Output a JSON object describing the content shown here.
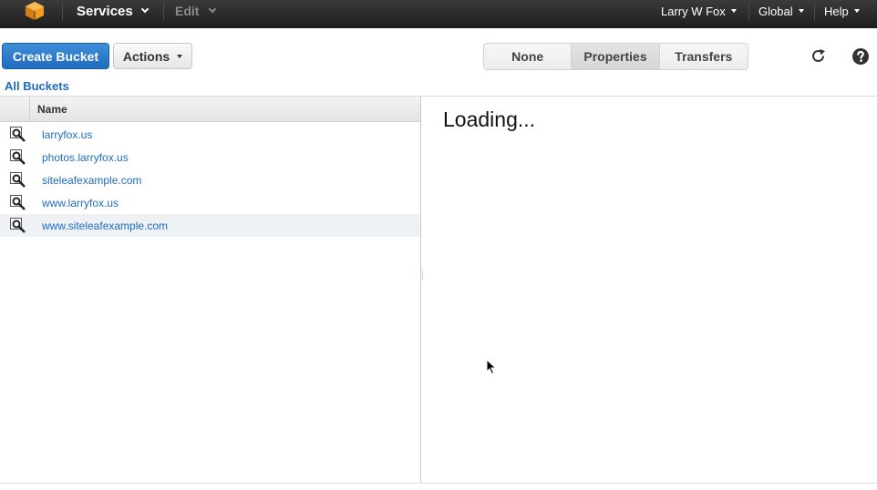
{
  "topnav": {
    "services_label": "Services",
    "edit_label": "Edit",
    "user_label": "Larry W Fox",
    "region_label": "Global",
    "help_label": "Help"
  },
  "toolbar": {
    "create_bucket_label": "Create Bucket",
    "actions_label": "Actions",
    "view_options": [
      {
        "label": "None",
        "active": false
      },
      {
        "label": "Properties",
        "active": true
      },
      {
        "label": "Transfers",
        "active": false
      }
    ]
  },
  "breadcrumb": {
    "all_buckets_label": "All Buckets"
  },
  "bucket_table": {
    "column_name": "Name",
    "rows": [
      {
        "name": "larryfox.us"
      },
      {
        "name": "photos.larryfox.us"
      },
      {
        "name": "siteleafexample.com"
      },
      {
        "name": "www.larryfox.us"
      },
      {
        "name": "www.siteleafexample.com"
      }
    ]
  },
  "detail_pane": {
    "loading_text": "Loading..."
  },
  "colors": {
    "nav_bg": "#232323",
    "primary_button": "#2b7bd0",
    "link": "#1f6cbf",
    "logo": "#f29b1e",
    "row_hover": "#eef2f5"
  }
}
